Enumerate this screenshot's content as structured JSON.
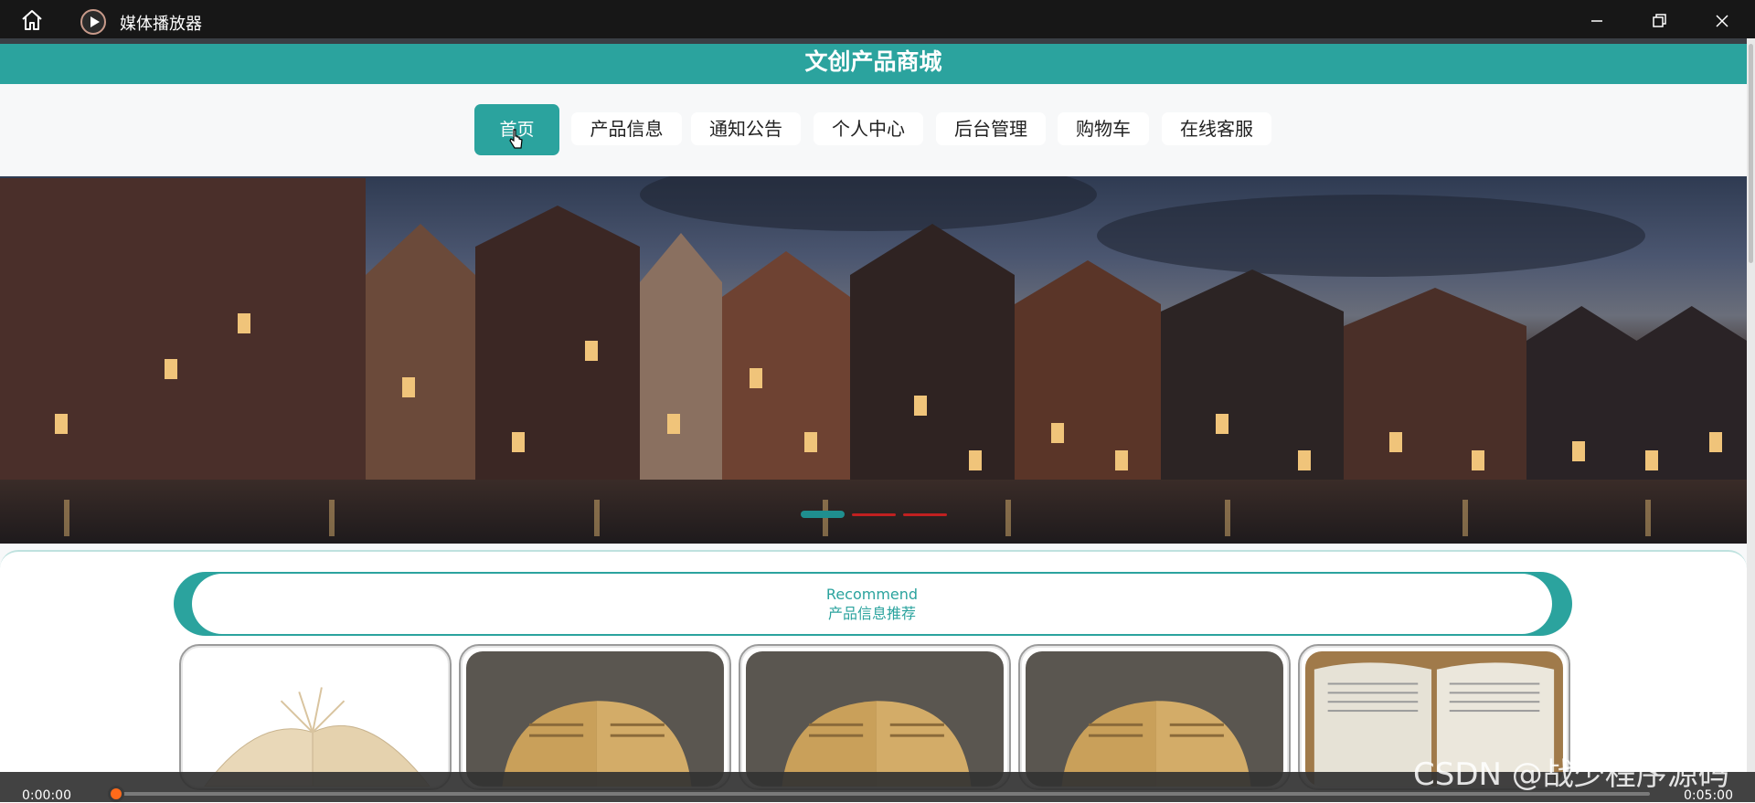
{
  "window": {
    "title": "媒体播放器"
  },
  "site": {
    "title": "文创产品商城",
    "nav": [
      {
        "label": "首页",
        "active": true
      },
      {
        "label": "产品信息"
      },
      {
        "label": "通知公告"
      },
      {
        "label": "个人中心"
      },
      {
        "label": "后台管理"
      },
      {
        "label": "购物车"
      },
      {
        "label": "在线客服"
      }
    ],
    "recommend": {
      "title_en": "Recommend",
      "title_cn": "产品信息推荐"
    },
    "carousel": {
      "slides": 3,
      "active_index": 0
    }
  },
  "player": {
    "current_time": "0:00:00",
    "total_time": "0:05:00",
    "progress": 0.0
  },
  "watermark": "CSDN @战少程序源码",
  "colors": {
    "accent": "#2ba39e",
    "player_accent": "#ff6a1a",
    "titlebar": "#171717"
  }
}
